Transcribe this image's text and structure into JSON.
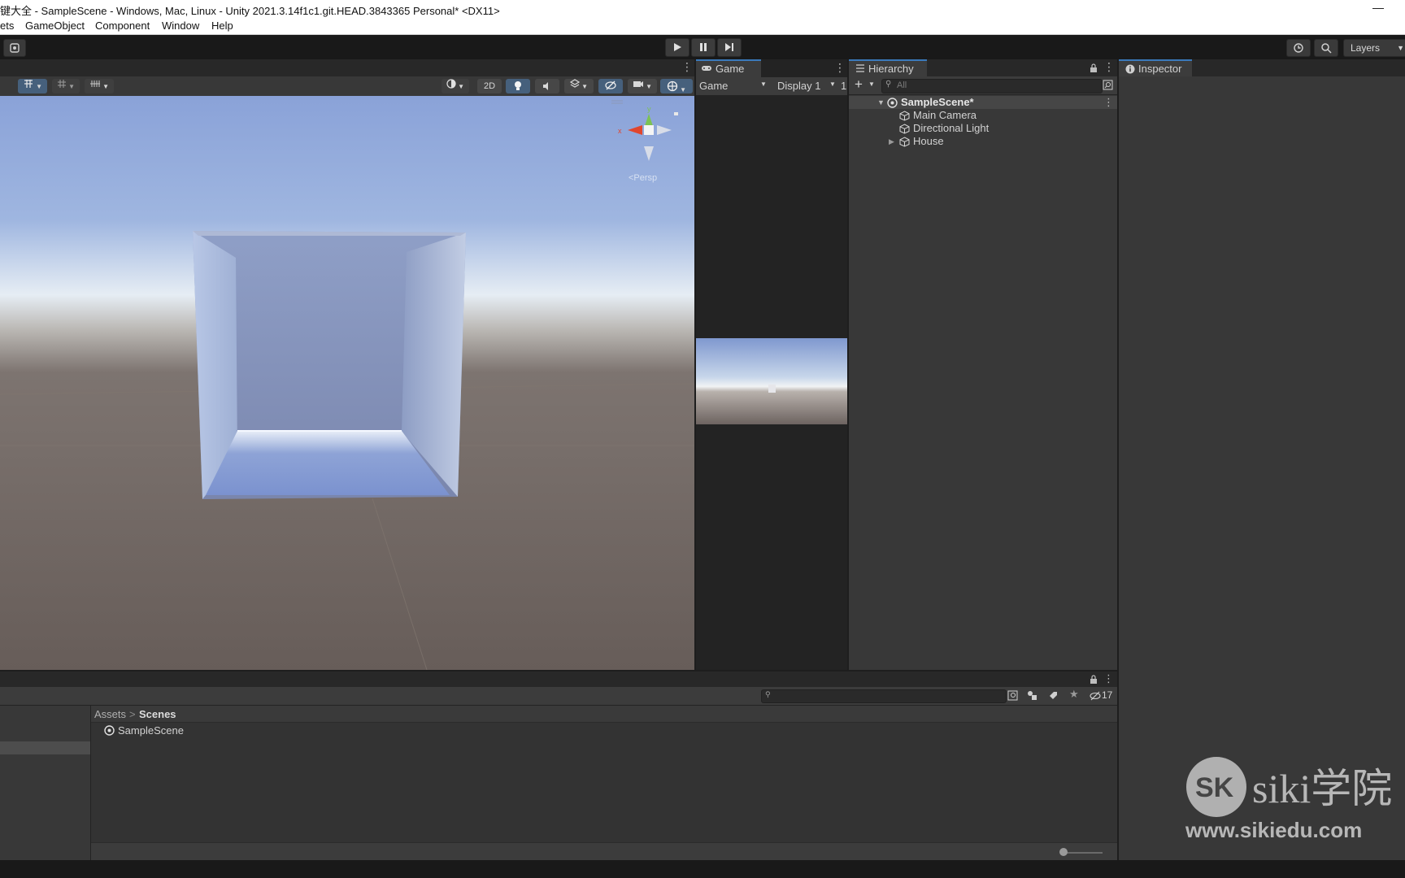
{
  "window": {
    "title": "键大全 - SampleScene - Windows, Mac, Linux - Unity 2021.3.14f1c1.git.HEAD.3843365 Personal* <DX11>",
    "minimize_glyph": "—"
  },
  "menu": {
    "items": [
      "ets",
      "GameObject",
      "Component",
      "Window",
      "Help"
    ]
  },
  "toolbar": {
    "layers_label": "Layers"
  },
  "scene": {
    "btn_2d": "2D",
    "gizmo": {
      "persp_label": "<Persp",
      "axis_y": "y",
      "axis_x": "x"
    }
  },
  "game": {
    "tab_label": "Game",
    "mode_select": "Game",
    "display_select": "Display 1",
    "display_suffix": "1"
  },
  "hierarchy": {
    "tab_label": "Hierarchy",
    "search_placeholder": "All",
    "scene_name": "SampleScene*",
    "items": [
      {
        "label": "Main Camera",
        "expandable": false
      },
      {
        "label": "Directional Light",
        "expandable": false
      },
      {
        "label": "House",
        "expandable": true
      }
    ]
  },
  "inspector": {
    "tab_label": "Inspector"
  },
  "project": {
    "hidden_count": "17",
    "breadcrumb": {
      "root": "Assets",
      "separator": ">",
      "current": "Scenes"
    },
    "items": [
      "SampleScene"
    ]
  },
  "watermark": {
    "text_top": "siki学院",
    "text_bottom": "www.sikiedu.com"
  },
  "colors": {
    "accent": "#3a79bb",
    "panel_bg": "#383838",
    "toolbar_bg": "#191919",
    "sky_top": "#8aa2d8",
    "ground": "#6b605b"
  }
}
